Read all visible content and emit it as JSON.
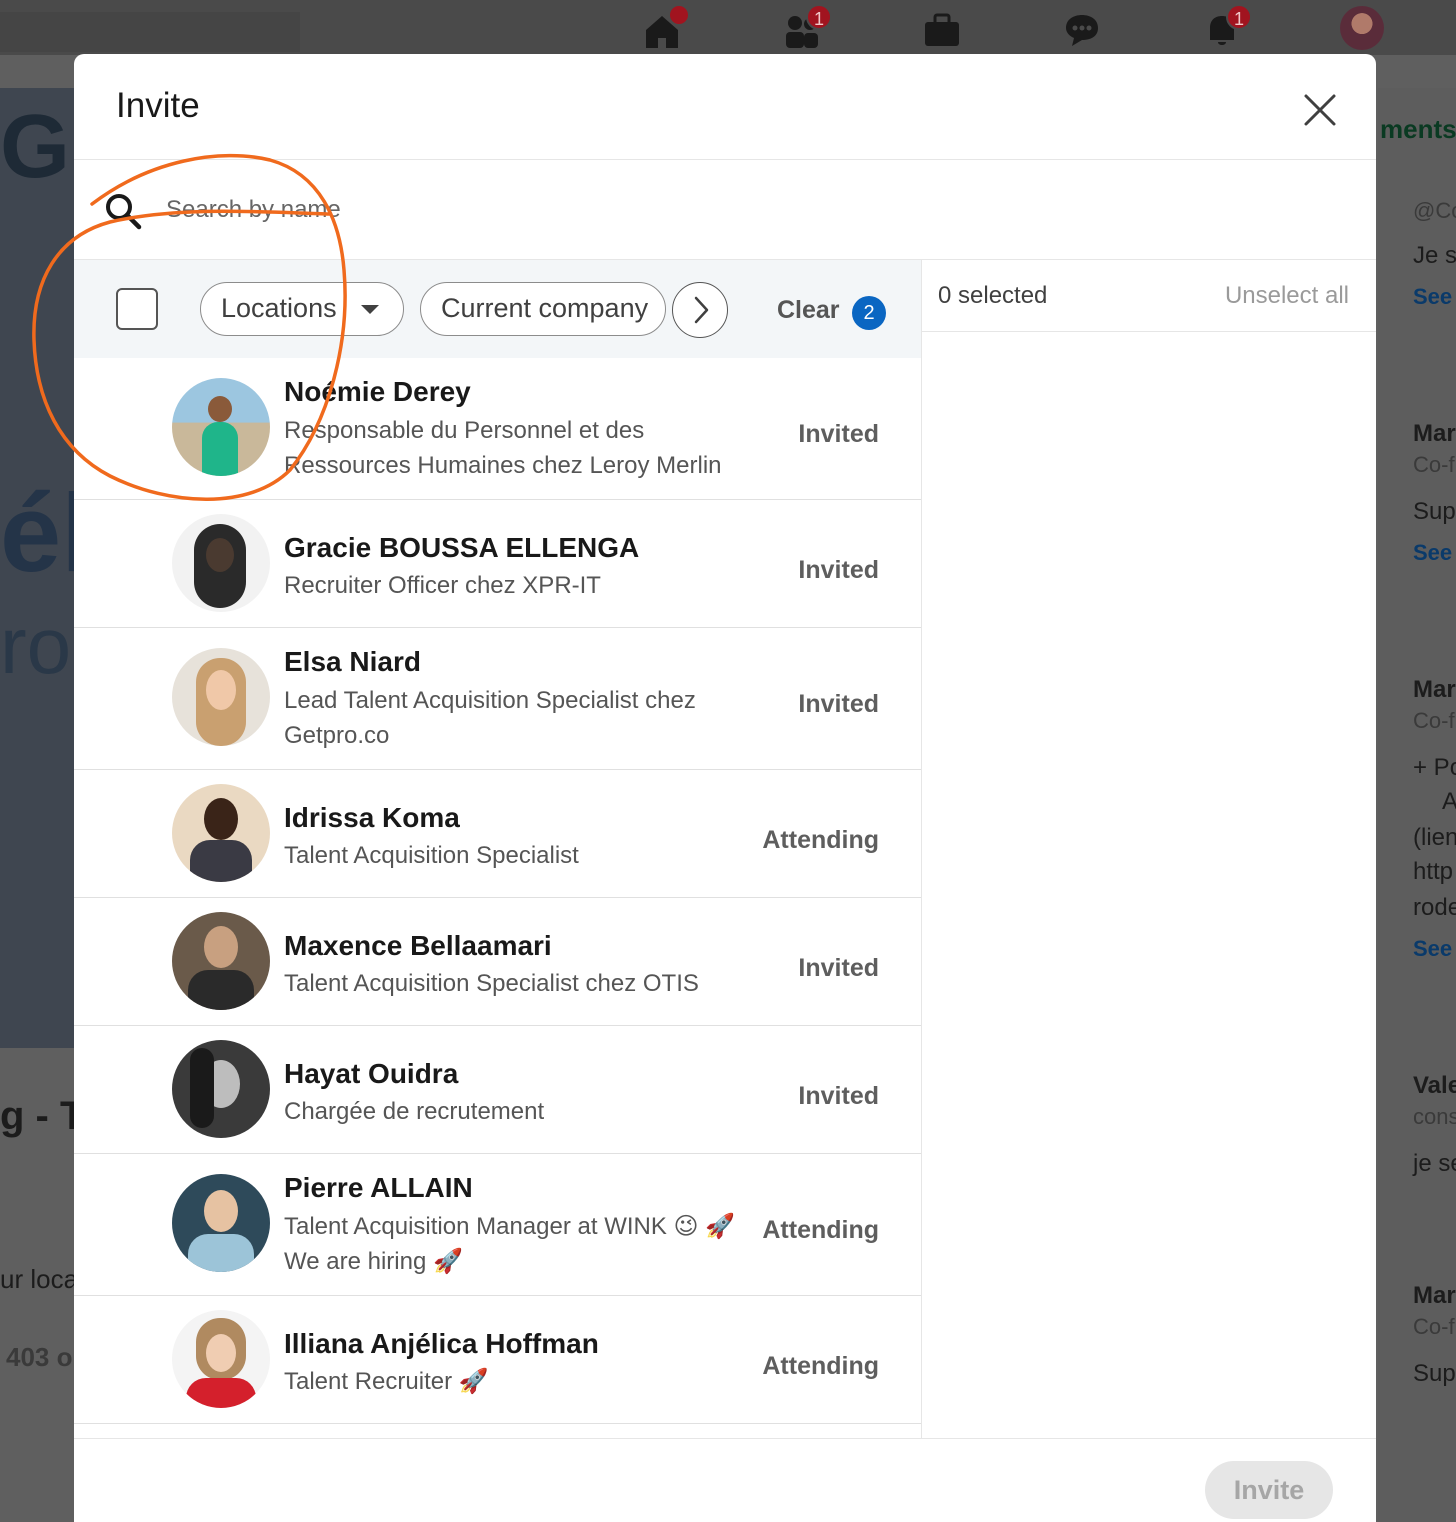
{
  "background": {
    "nav_badges": [
      "1",
      "1"
    ],
    "left_fragments": [
      "g - Ta",
      "ur local",
      "403 o"
    ],
    "left_big": [
      "GR",
      "élé",
      "ron"
    ],
    "right_fragments": [
      {
        "text": "ments",
        "style": "green"
      },
      {
        "text": "@Co",
        "style": "muted"
      },
      {
        "text": "Je s",
        "style": ""
      },
      {
        "text": "See",
        "style": "link"
      },
      {
        "text": "Mar",
        "style": "bold"
      },
      {
        "text": "Co-f",
        "style": "muted"
      },
      {
        "text": "Sup",
        "style": ""
      },
      {
        "text": "See",
        "style": "link"
      },
      {
        "text": "Mar",
        "style": "bold"
      },
      {
        "text": "Co-f",
        "style": "muted"
      },
      {
        "text": "+ Po",
        "style": ""
      },
      {
        "text": "A",
        "style": ""
      },
      {
        "text": "(lien",
        "style": ""
      },
      {
        "text": "http",
        "style": ""
      },
      {
        "text": "rode",
        "style": ""
      },
      {
        "text": "See",
        "style": "link"
      },
      {
        "text": "Vale",
        "style": "bold"
      },
      {
        "text": "cons",
        "style": "muted"
      },
      {
        "text": "je se",
        "style": ""
      },
      {
        "text": "Mar",
        "style": "bold"
      },
      {
        "text": "Co-f",
        "style": "muted"
      },
      {
        "text": "Sup",
        "style": ""
      }
    ]
  },
  "modal": {
    "title": "Invite",
    "search": {
      "placeholder": "Search by name",
      "value": ""
    },
    "filters": {
      "locations_label": "Locations",
      "company_label": "Current company",
      "clear_label": "Clear",
      "clear_count": "2"
    },
    "selection": {
      "count_label": "0 selected",
      "unselect_label": "Unselect all"
    },
    "invite_label": "Invite",
    "people": [
      {
        "name": "Noémie Derey",
        "headline": "Responsable du Personnel et des Ressources Humaines chez Leroy Merlin",
        "status": "Invited"
      },
      {
        "name": "Gracie BOUSSA ELLENGA",
        "headline": "Recruiter Officer chez XPR-IT",
        "status": "Invited"
      },
      {
        "name": "Elsa Niard",
        "headline": "Lead Talent Acquisition Specialist chez Getpro.co",
        "status": "Invited"
      },
      {
        "name": "Idrissa Koma",
        "headline": "Talent Acquisition Specialist",
        "status": "Attending"
      },
      {
        "name": "Maxence Bellaamari",
        "headline": "Talent Acquisition Specialist chez OTIS",
        "status": "Invited"
      },
      {
        "name": "Hayat Ouidra",
        "headline": "Chargée de recrutement",
        "status": "Invited"
      },
      {
        "name": "Pierre ALLAIN",
        "headline": "Talent Acquisition Manager at WINK 😉 🚀 We are hiring 🚀",
        "status": "Attending"
      },
      {
        "name": "Illiana Anjélica Hoffman",
        "headline": "Talent Recruiter 🚀",
        "status": "Attending"
      }
    ]
  },
  "colors": {
    "accent": "#0a66c2",
    "annotation": "#f06a1d",
    "overlay": "#5f5f5f"
  }
}
